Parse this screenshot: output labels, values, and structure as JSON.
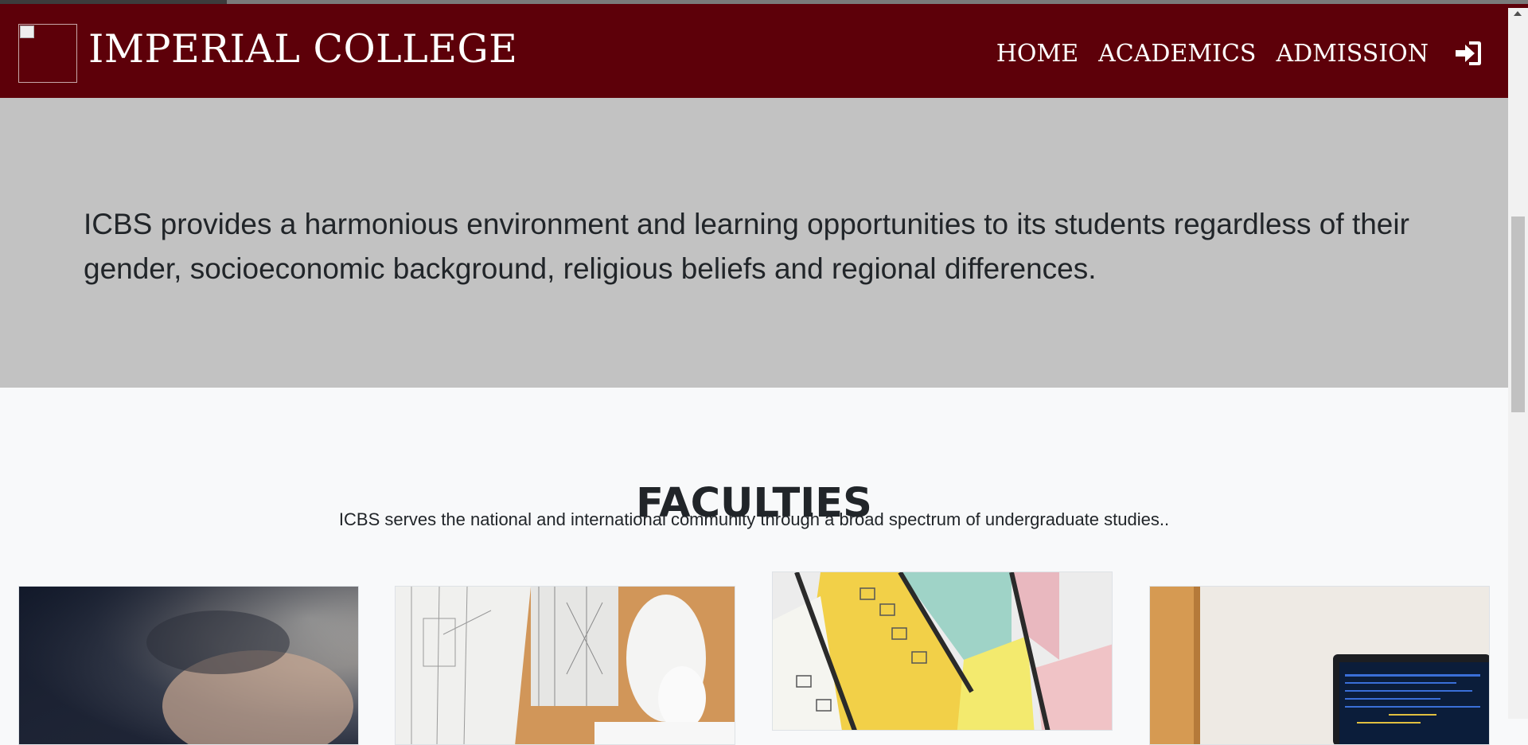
{
  "header": {
    "brand": "IMPERIAL COLLEGE",
    "nav": [
      "HOME",
      "ACADEMICS",
      "ADMISSION"
    ],
    "logo_alt": "logo",
    "login_icon": "sign-in-icon"
  },
  "hero": {
    "text": "ICBS provides a harmonious environment and learning opportunities to its students regardless of their gender, socioeconomic background, religious beliefs and regional differences."
  },
  "faculties": {
    "title": "FACULTIES",
    "subtitle": "ICBS serves the national and international community through a broad spectrum of undergraduate studies.."
  },
  "colors": {
    "brand": "#5d0009",
    "hero_bg": "#c2c2c2",
    "page_bg": "#f8f9fa"
  }
}
